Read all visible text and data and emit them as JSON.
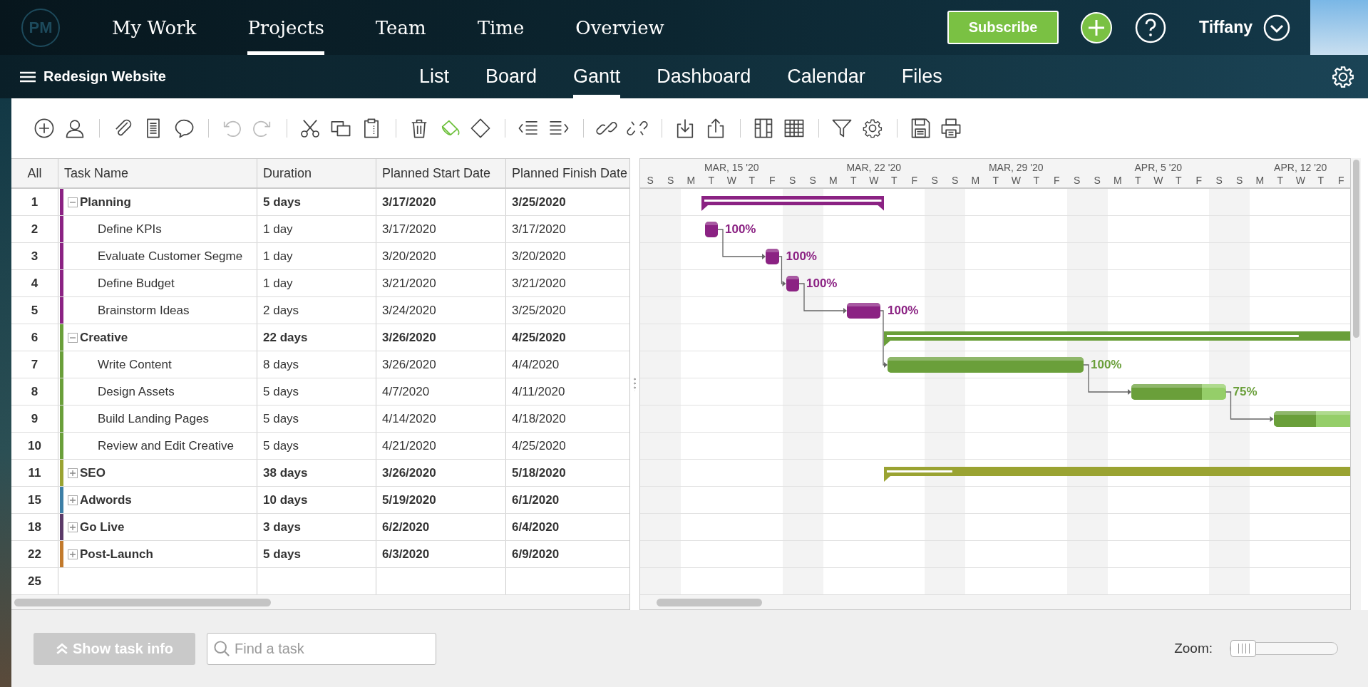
{
  "app": {
    "logo": "PM",
    "nav": [
      {
        "label": "My Work",
        "selected": false
      },
      {
        "label": "Projects",
        "selected": true
      },
      {
        "label": "Team",
        "selected": false
      },
      {
        "label": "Time",
        "selected": false
      },
      {
        "label": "Overview",
        "selected": false
      }
    ],
    "subscribe": "Subscribe",
    "user": "Tiffany"
  },
  "project": {
    "title": "Redesign Website",
    "views": [
      {
        "label": "List",
        "selected": false
      },
      {
        "label": "Board",
        "selected": false
      },
      {
        "label": "Gantt",
        "selected": true
      },
      {
        "label": "Dashboard",
        "selected": false
      },
      {
        "label": "Calendar",
        "selected": false
      },
      {
        "label": "Files",
        "selected": false
      }
    ]
  },
  "toolbar": [
    [
      {
        "kind": "add",
        "disabled": false
      },
      {
        "kind": "user",
        "disabled": false
      }
    ],
    [
      {
        "kind": "attach",
        "disabled": false
      },
      {
        "kind": "document",
        "disabled": false
      },
      {
        "kind": "comment",
        "disabled": false
      }
    ],
    [
      {
        "kind": "undo",
        "disabled": true
      },
      {
        "kind": "redo",
        "disabled": true
      }
    ],
    [
      {
        "kind": "cut",
        "disabled": false
      },
      {
        "kind": "copy",
        "disabled": false
      },
      {
        "kind": "paste",
        "disabled": false
      }
    ],
    [
      {
        "kind": "delete",
        "disabled": false
      },
      {
        "kind": "paint",
        "disabled": false
      },
      {
        "kind": "milestone",
        "disabled": false
      }
    ],
    [
      {
        "kind": "outdent",
        "disabled": false
      },
      {
        "kind": "indent",
        "disabled": false
      }
    ],
    [
      {
        "kind": "link",
        "disabled": false
      },
      {
        "kind": "unlink",
        "disabled": false
      }
    ],
    [
      {
        "kind": "import",
        "disabled": false
      },
      {
        "kind": "export",
        "disabled": false
      }
    ],
    [
      {
        "kind": "columns",
        "disabled": false
      },
      {
        "kind": "table",
        "disabled": false
      }
    ],
    [
      {
        "kind": "filter",
        "disabled": false
      },
      {
        "kind": "settings",
        "disabled": false
      }
    ],
    [
      {
        "kind": "save",
        "disabled": false
      },
      {
        "kind": "print",
        "disabled": false
      }
    ]
  ],
  "table": {
    "columns": [
      "All",
      "Task Name",
      "Duration",
      "Planned Start Date",
      "Planned Finish Date"
    ],
    "groups": [
      {
        "number": "1",
        "name": "Planning",
        "duration": "5 days",
        "start": "3/17/2020",
        "finish": "3/25/2020",
        "color": "#8b2283",
        "expanded": true,
        "level": 1,
        "children": [
          {
            "number": "2",
            "name": "Define KPIs",
            "duration": "1 day",
            "start": "3/17/2020",
            "finish": "3/17/2020",
            "level": 1,
            "label": "100%",
            "linked": false
          },
          {
            "number": "3",
            "name": "Evaluate Customer Segme",
            "duration": "1 day",
            "start": "3/20/2020",
            "finish": "3/20/2020",
            "level": 1,
            "label": "100%",
            "linked": true
          },
          {
            "number": "4",
            "name": "Define Budget",
            "duration": "1 day",
            "start": "3/21/2020",
            "finish": "3/21/2020",
            "level": 1,
            "label": "100%",
            "linked": true
          },
          {
            "number": "5",
            "name": "Brainstorm Ideas",
            "duration": "2 days",
            "start": "3/24/2020",
            "finish": "3/25/2020",
            "level": 1,
            "label": "100%",
            "linked": true
          }
        ]
      },
      {
        "number": "6",
        "name": "Creative",
        "duration": "22 days",
        "start": "3/26/2020",
        "finish": "4/25/2020",
        "color": "#6a9f3a",
        "expanded": true,
        "level": 0.66,
        "children": [
          {
            "number": "7",
            "name": "Write Content",
            "duration": "8 days",
            "start": "3/26/2020",
            "finish": "4/4/2020",
            "level": 1,
            "label": "100%",
            "linked": true
          },
          {
            "number": "8",
            "name": "Design Assets",
            "duration": "5 days",
            "start": "4/7/2020",
            "finish": "4/11/2020",
            "level": 0.75,
            "label": "75%",
            "linked": true
          },
          {
            "number": "9",
            "name": "Build Landing Pages",
            "duration": "5 days",
            "start": "4/14/2020",
            "finish": "4/18/2020",
            "level": 0.45,
            "linked": true
          },
          {
            "number": "10",
            "name": "Review and Edit Creative",
            "duration": "5 days",
            "start": "4/21/2020",
            "finish": "4/25/2020",
            "linked": false
          }
        ]
      },
      {
        "number": "11",
        "name": "SEO",
        "duration": "38 days",
        "start": "3/26/2020",
        "finish": "5/18/2020",
        "color": "#9aa332",
        "expanded": false,
        "level": 0.06
      },
      {
        "number": "15",
        "name": "Adwords",
        "duration": "10 days",
        "start": "5/19/2020",
        "finish": "6/1/2020",
        "color": "#3d7fa6",
        "expanded": false
      },
      {
        "number": "18",
        "name": "Go Live",
        "duration": "3 days",
        "start": "6/2/2020",
        "finish": "6/4/2020",
        "color": "#5b3a68",
        "expanded": false
      },
      {
        "number": "22",
        "name": "Post-Launch",
        "duration": "5 days",
        "start": "6/3/2020",
        "finish": "6/9/2020",
        "color": "#c27a2c",
        "expanded": false
      }
    ],
    "blank_row": "25"
  },
  "gantt": {
    "lead_days": [
      "S"
    ],
    "weeks": [
      {
        "label": "MAR, 15 '20",
        "days": [
          "S",
          "M",
          "T",
          "W",
          "T",
          "F",
          "S"
        ]
      },
      {
        "label": "MAR, 22 '20",
        "days": [
          "S",
          "M",
          "T",
          "W",
          "T",
          "F",
          "S"
        ]
      },
      {
        "label": "MAR, 29 '20",
        "days": [
          "S",
          "M",
          "T",
          "W",
          "T",
          "F",
          "S"
        ]
      },
      {
        "label": "APR, 5 '20",
        "days": [
          "S",
          "M",
          "T",
          "W",
          "T",
          "F",
          "S"
        ]
      },
      {
        "label": "APR, 12 '20",
        "days": [
          "S",
          "M",
          "T",
          "W",
          "T",
          "F"
        ]
      }
    ]
  },
  "footer": {
    "task_info": "Show task info",
    "search": {
      "placeholder": "Find a task"
    },
    "zoom": {
      "label": "Zoom:",
      "level": 0
    }
  }
}
